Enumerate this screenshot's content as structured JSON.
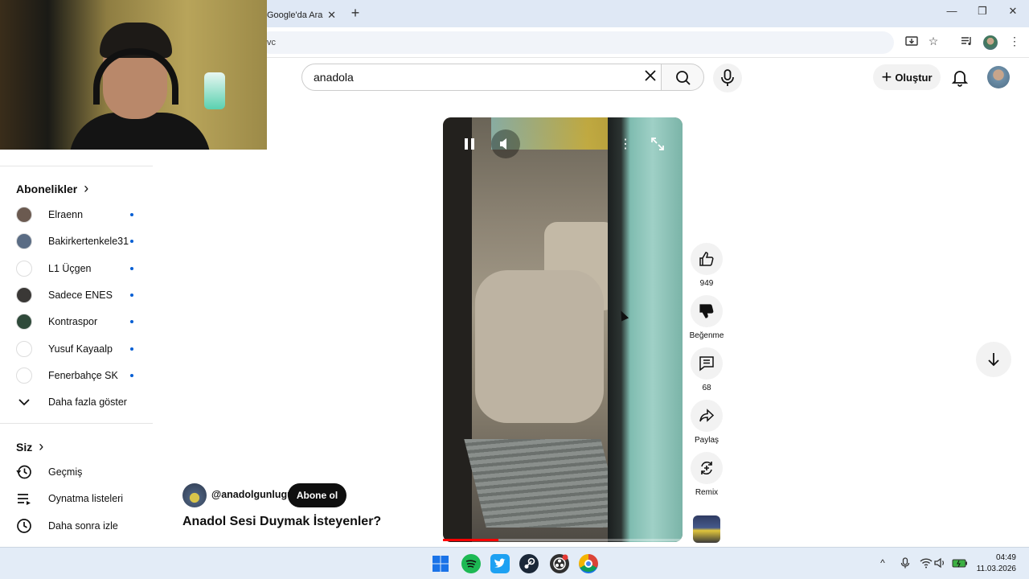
{
  "browser": {
    "tab_title": "Google'da Ara",
    "tab_close": "✕",
    "new_tab": "+",
    "url_fragment": "vc",
    "window_controls": [
      "—",
      "❐",
      "✕"
    ]
  },
  "header": {
    "search_value": "anadola",
    "create_label": "Oluştur",
    "create_plus": "+"
  },
  "sidebar": {
    "subscriptions_title": "Abonelikler",
    "chevron": "›",
    "subscriptions": [
      {
        "name": "Elraenn",
        "color": "#6b5a50"
      },
      {
        "name": "Bakirkertenkele31",
        "color": "#5a6c84"
      },
      {
        "name": "L1 Üçgen",
        "color": "#ffffff"
      },
      {
        "name": "Sadece ENES",
        "color": "#3a3836"
      },
      {
        "name": "Kontraspor",
        "color": "#2f4a3a"
      },
      {
        "name": "Yusuf Kayaalp",
        "color": "#ffffff"
      },
      {
        "name": "Fenerbahçe SK",
        "color": "#ffffff"
      }
    ],
    "show_more": "Daha fazla göster",
    "you_title": "Siz",
    "nav": [
      {
        "label": "Geçmiş",
        "icon": "history-icon"
      },
      {
        "label": "Oynatma listeleri",
        "icon": "playlists-icon"
      },
      {
        "label": "Daha sonra izle",
        "icon": "watch-later-icon"
      }
    ]
  },
  "short": {
    "channel": "@anadolgunlugu",
    "subscribe_label": "Abone ol",
    "title": "Anadol Sesi Duymak İsteyenler?",
    "progress": 0.23,
    "likes": "949",
    "dislike_label": "Beğenme",
    "comments": "68",
    "share_label": "Paylaş",
    "remix_label": "Remix"
  },
  "taskbar": {
    "time": "04:49",
    "date": "11.03.2026",
    "tray_up": "^"
  }
}
